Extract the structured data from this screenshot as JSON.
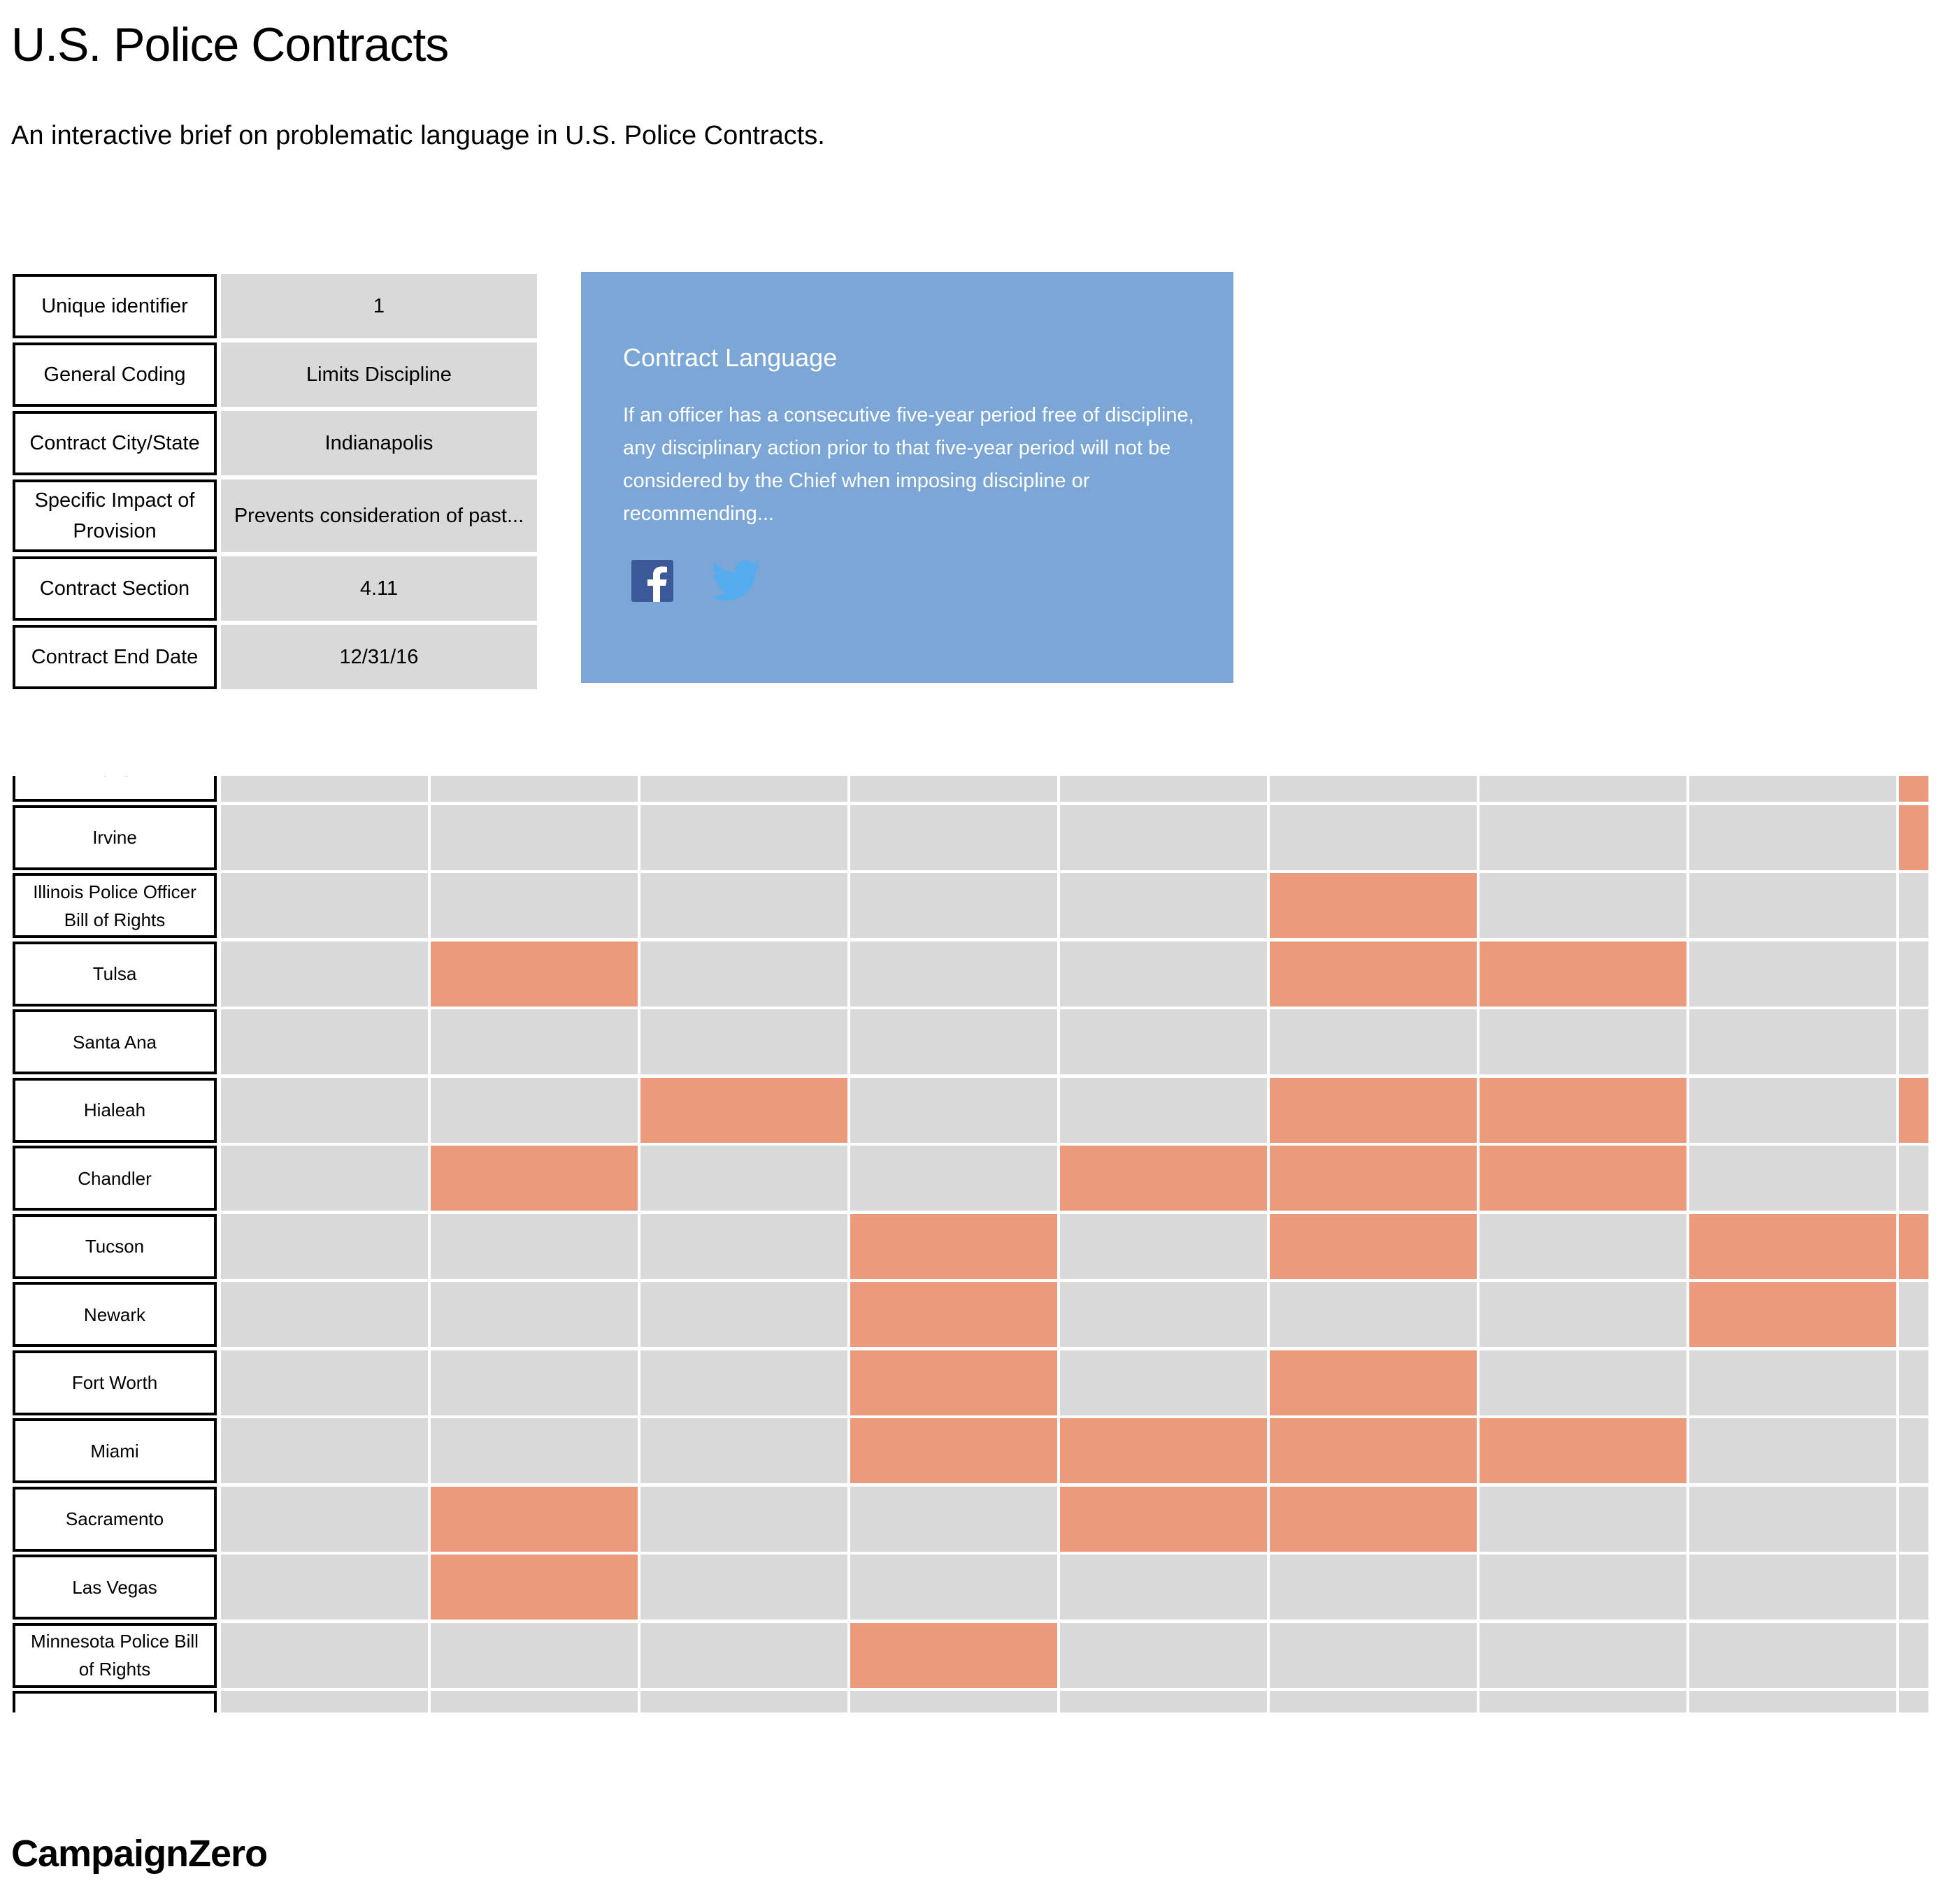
{
  "header": {
    "title": "U.S. Police Contracts",
    "subtitle": "An interactive brief on problematic language in U.S. Police Contracts."
  },
  "details": [
    {
      "label": "Unique identifier",
      "value": "1"
    },
    {
      "label": "General Coding",
      "value": "Limits Discipline"
    },
    {
      "label": "Contract City/State",
      "value": "Indianapolis"
    },
    {
      "label": "Specific Impact of Provision",
      "value": "Prevents consideration of past..."
    },
    {
      "label": "Contract Section",
      "value": "4.11"
    },
    {
      "label": "Contract End Date",
      "value": "12/31/16"
    }
  ],
  "card": {
    "title": "Contract Language",
    "text": "If an officer has a consecutive five-year period free of discipline, any disciplinary action prior to that five-year period will not be considered by the Chief when imposing discipline or recommending...",
    "icons": [
      "facebook-icon",
      "twitter-icon"
    ]
  },
  "colors": {
    "cell_empty": "#d9d9d9",
    "cell_flagged": "#eb9a7c",
    "card_bg": "#7ba6d5",
    "facebook": "#3b5998",
    "twitter": "#55acee"
  },
  "grid": {
    "rows": [
      {
        "city": "Anaheim",
        "flags": [
          0,
          0,
          0,
          0,
          0,
          0,
          0,
          0,
          1
        ]
      },
      {
        "city": "Irvine",
        "flags": [
          0,
          0,
          0,
          0,
          0,
          0,
          0,
          0,
          1
        ]
      },
      {
        "city": "Illinois Police Officer Bill of Rights",
        "flags": [
          0,
          0,
          0,
          0,
          0,
          1,
          0,
          0,
          0
        ]
      },
      {
        "city": "Tulsa",
        "flags": [
          0,
          1,
          0,
          0,
          0,
          1,
          1,
          0,
          0
        ]
      },
      {
        "city": "Santa Ana",
        "flags": [
          0,
          0,
          0,
          0,
          0,
          0,
          0,
          0,
          0
        ]
      },
      {
        "city": "Hialeah",
        "flags": [
          0,
          0,
          1,
          0,
          0,
          1,
          1,
          0,
          1
        ]
      },
      {
        "city": "Chandler",
        "flags": [
          0,
          1,
          0,
          0,
          1,
          1,
          1,
          0,
          0
        ]
      },
      {
        "city": "Tucson",
        "flags": [
          0,
          0,
          0,
          1,
          0,
          1,
          0,
          1,
          1
        ]
      },
      {
        "city": "Newark",
        "flags": [
          0,
          0,
          0,
          1,
          0,
          0,
          0,
          1,
          0
        ]
      },
      {
        "city": "Fort Worth",
        "flags": [
          0,
          0,
          0,
          1,
          0,
          1,
          0,
          0,
          0
        ]
      },
      {
        "city": "Miami",
        "flags": [
          0,
          0,
          0,
          1,
          1,
          1,
          1,
          0,
          0
        ]
      },
      {
        "city": "Sacramento",
        "flags": [
          0,
          1,
          0,
          0,
          1,
          1,
          0,
          0,
          0
        ]
      },
      {
        "city": "Las Vegas",
        "flags": [
          0,
          1,
          0,
          0,
          0,
          0,
          0,
          0,
          0
        ]
      },
      {
        "city": "Minnesota Police Bill of Rights",
        "flags": [
          0,
          0,
          0,
          1,
          0,
          0,
          0,
          0,
          0
        ]
      },
      {
        "city": "",
        "flags": [
          0,
          0,
          0,
          0,
          0,
          0,
          0,
          0,
          0
        ]
      }
    ]
  },
  "footer": {
    "brand": "CampaignZero"
  }
}
